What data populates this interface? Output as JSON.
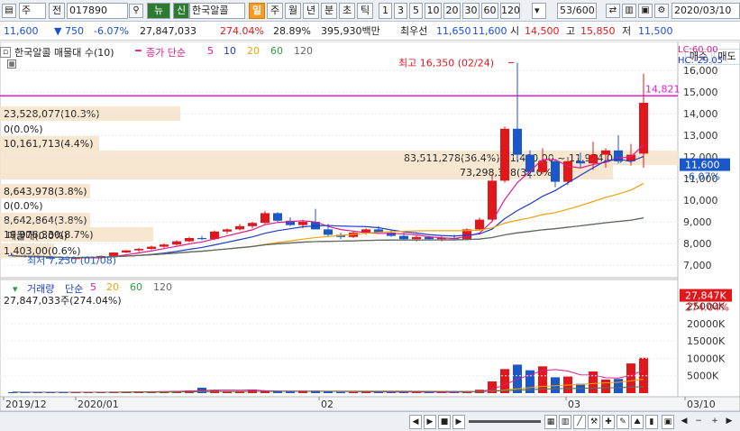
{
  "toolbar": {
    "market": "주",
    "period_btn": "전",
    "code": "017890",
    "search_icon": "magnifier-icon",
    "news_btn": "뉴",
    "new_btn": "신",
    "stock_name": "한국알콜",
    "tabs": [
      "일",
      "주",
      "월",
      "년",
      "분",
      "초",
      "틱"
    ],
    "intervals": [
      "1",
      "3",
      "5",
      "10",
      "20",
      "30",
      "60",
      "120"
    ],
    "page": "53/600",
    "date": "2020/03/10"
  },
  "quote": {
    "price": "11,600",
    "change": "750",
    "change_pct": "-6.07%",
    "volume": "27,847,033",
    "vol_ratio": "274.04%",
    "turnover": "28.89%",
    "amount": "395,930백만",
    "best_label": "최우선",
    "ask": "11,650",
    "bid": "11,600",
    "open_label": "시",
    "open": "14,500",
    "high_label": "고",
    "high": "15,850",
    "low_label": "저",
    "low": "11,500"
  },
  "right_buttons": {
    "buy": "매수",
    "sell": "매도"
  },
  "legend": {
    "title": "한국알콜 매물대 수(10)",
    "close_label": "종가 단순",
    "ma": [
      "5",
      "10",
      "20",
      "60",
      "120"
    ]
  },
  "ma_colors": [
    "#e21b8b",
    "#1d3cc9",
    "#f0a30a",
    "#2e9a44",
    "#666666"
  ],
  "annotations": {
    "high_marker": "최고 16,350 (02/24)",
    "low_marker": "최저 7,230 (01/08)",
    "ma_label": "매물대(0.0%)",
    "top_price": "14,821",
    "lc": "LC:60.00",
    "hc": "HC:-29.05",
    "current_price": "11,600",
    "current_pct": "-6.07%"
  },
  "profile_bars": [
    "23,528,077(10.3%)",
    "0(0.0%)",
    "10,161,713(4.4%)",
    "83,511,278(36.4%)(11,400.00 ~ 11,974.00)",
    "73,298,308(32.0%)",
    "8,643,978(3.8%)",
    "0(0.0%)",
    "8,642,864(3.8%)",
    "19,976,330(8.7%)",
    "1,403,00(0.6%)"
  ],
  "price_axis": [
    "16,000",
    "15,000",
    "14,000",
    "13,000",
    "12,000",
    "11,000",
    "10,000",
    "9,000",
    "8,000",
    "7,000"
  ],
  "volume": {
    "title": "거래량",
    "ma_label": "단순",
    "ma": [
      "5",
      "20",
      "60",
      "120"
    ],
    "current": "27,847,033주(274.04%)",
    "right_value": "27,847K",
    "right_pct": "274.04%",
    "axis": [
      "25000K",
      "20000K",
      "15000K",
      "10000K",
      "5000K"
    ]
  },
  "dates": [
    "2019/12",
    "2020/01",
    "02",
    "03",
    "03/10"
  ],
  "chart_data": {
    "type": "candlestick",
    "candles": [
      [
        7450,
        7500,
        7380,
        7420
      ],
      [
        7420,
        7480,
        7350,
        7400
      ],
      [
        7400,
        7450,
        7300,
        7380
      ],
      [
        7380,
        7420,
        7250,
        7300
      ],
      [
        7300,
        7350,
        7230,
        7280
      ],
      [
        7280,
        7350,
        7250,
        7320
      ],
      [
        7320,
        7400,
        7300,
        7380
      ],
      [
        7380,
        7450,
        7330,
        7420
      ],
      [
        7420,
        7600,
        7400,
        7580
      ],
      [
        7580,
        7700,
        7550,
        7680
      ],
      [
        7680,
        7800,
        7600,
        7750
      ],
      [
        7750,
        7900,
        7700,
        7850
      ],
      [
        7850,
        8000,
        7800,
        7950
      ],
      [
        7950,
        8150,
        7900,
        8100
      ],
      [
        8100,
        8300,
        8050,
        8250
      ],
      [
        8250,
        8350,
        8150,
        8200
      ],
      [
        8200,
        8600,
        8150,
        8550
      ],
      [
        8550,
        8700,
        8450,
        8650
      ],
      [
        8650,
        8900,
        8600,
        8800
      ],
      [
        8800,
        9000,
        8700,
        8950
      ],
      [
        8950,
        9500,
        8900,
        9400
      ],
      [
        9400,
        9450,
        9000,
        9050
      ],
      [
        9050,
        9200,
        8800,
        8850
      ],
      [
        8850,
        9100,
        8700,
        9000
      ],
      [
        9000,
        9600,
        8900,
        8650
      ],
      [
        8650,
        8900,
        8300,
        8400
      ],
      [
        8400,
        8500,
        8200,
        8300
      ],
      [
        8300,
        8600,
        8250,
        8500
      ],
      [
        8500,
        8700,
        8400,
        8650
      ],
      [
        8650,
        8800,
        8450,
        8500
      ],
      [
        8500,
        8600,
        8300,
        8350
      ],
      [
        8350,
        8500,
        8150,
        8200
      ],
      [
        8200,
        8400,
        8100,
        8300
      ],
      [
        8300,
        8350,
        8150,
        8200
      ],
      [
        8200,
        8350,
        8100,
        8250
      ],
      [
        8250,
        8400,
        8150,
        8200
      ],
      [
        8200,
        8700,
        8150,
        8650
      ],
      [
        8650,
        9200,
        8600,
        9100
      ],
      [
        9100,
        11200,
        9000,
        10900
      ],
      [
        10900,
        13400,
        10800,
        13300
      ],
      [
        13300,
        16350,
        11800,
        12100
      ],
      [
        12100,
        12300,
        11000,
        11300
      ],
      [
        11300,
        12400,
        11200,
        11800
      ],
      [
        11800,
        11900,
        10600,
        10850
      ],
      [
        10850,
        12000,
        10700,
        11800
      ],
      [
        11800,
        12200,
        11500,
        11700
      ],
      [
        11700,
        12700,
        11400,
        12100
      ],
      [
        12100,
        12400,
        11500,
        12300
      ],
      [
        12300,
        13000,
        11700,
        11800
      ],
      [
        11800,
        12600,
        11600,
        12100
      ],
      [
        12150,
        15850,
        11500,
        14500
      ]
    ],
    "volumes": [
      280,
      220,
      260,
      300,
      240,
      210,
      230,
      250,
      420,
      390,
      520,
      480,
      530,
      610,
      760,
      1550,
      870,
      540,
      470,
      1060,
      650,
      420,
      380,
      560,
      740,
      430,
      320,
      280,
      390,
      310,
      270,
      290,
      300,
      250,
      260,
      240,
      570,
      980,
      3360,
      6920,
      8190,
      6570,
      7700,
      4560,
      4770,
      2670,
      6240,
      3910,
      4090,
      8540,
      10180,
      24350,
      27850
    ],
    "ylim": [
      6500,
      16500
    ],
    "vol_ylim": [
      0,
      28000
    ]
  }
}
